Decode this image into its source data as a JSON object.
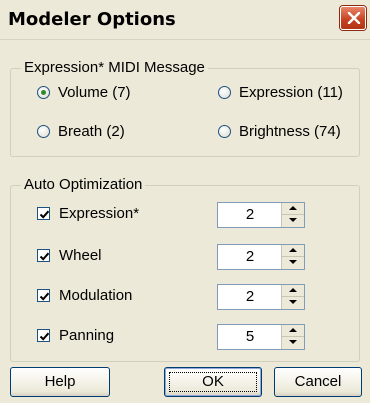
{
  "window": {
    "title": "Modeler Options"
  },
  "midi_group": {
    "legend": "Expression* MIDI Message",
    "options": [
      {
        "label": "Volume (7)",
        "checked": true
      },
      {
        "label": "Expression (11)",
        "checked": false
      },
      {
        "label": "Breath (2)",
        "checked": false
      },
      {
        "label": "Brightness (74)",
        "checked": false
      }
    ]
  },
  "auto_group": {
    "legend": "Auto Optimization",
    "rows": [
      {
        "label": "Expression*",
        "checked": true,
        "value": "2"
      },
      {
        "label": "Wheel",
        "checked": true,
        "value": "2"
      },
      {
        "label": "Modulation",
        "checked": true,
        "value": "2"
      },
      {
        "label": "Panning",
        "checked": true,
        "value": "5"
      }
    ]
  },
  "buttons": {
    "help": "Help",
    "ok": "OK",
    "cancel": "Cancel"
  },
  "colors": {
    "background": "#ece9d8",
    "radio_dot": "#2d8a2d",
    "close": "#c5401e"
  }
}
